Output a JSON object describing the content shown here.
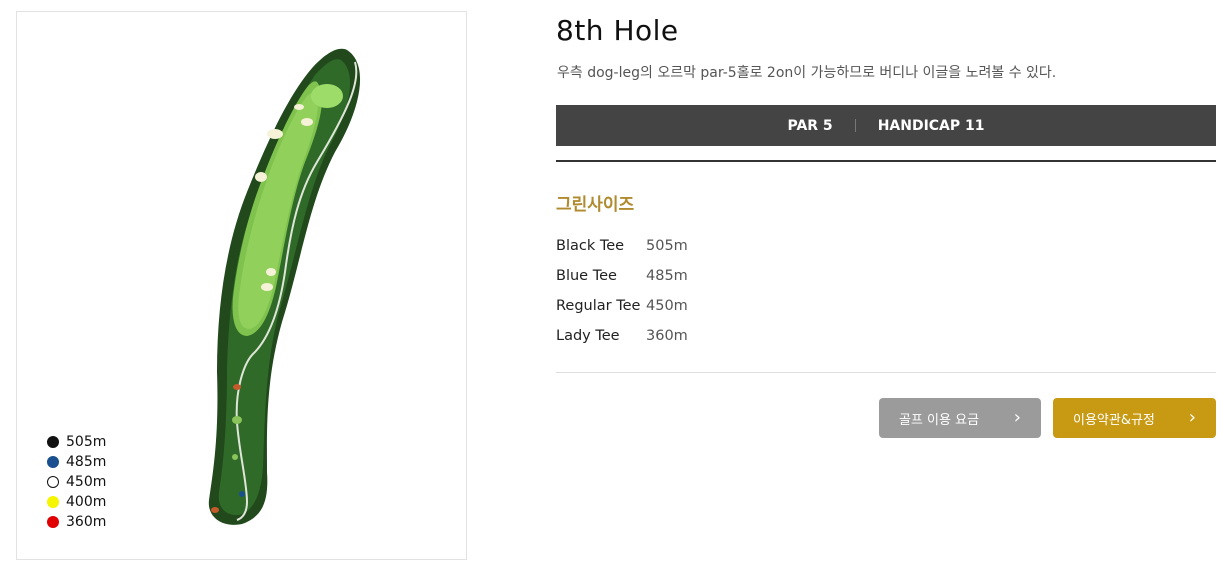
{
  "hole": {
    "title": "8th Hole",
    "description": "우측 dog-leg의 오르막 par-5홀로 2on이 가능하므로 버디나 이글을 노려볼 수 있다."
  },
  "info_bar": {
    "par": "PAR 5",
    "handicap": "HANDICAP 11"
  },
  "green_size": {
    "title": "그린사이즈",
    "tees": [
      {
        "name": "Black Tee",
        "distance": "505m"
      },
      {
        "name": "Blue Tee",
        "distance": "485m"
      },
      {
        "name": "Regular Tee",
        "distance": "450m"
      },
      {
        "name": "Lady Tee",
        "distance": "360m"
      }
    ]
  },
  "legend": [
    {
      "label": "505m",
      "color": "#111111"
    },
    {
      "label": "485m",
      "color": "#1a4f8f"
    },
    {
      "label": "450m",
      "color": "#ffffff"
    },
    {
      "label": "400m",
      "color": "#f5f500"
    },
    {
      "label": "360m",
      "color": "#e10000"
    }
  ],
  "buttons": {
    "fee": "골프 이용 요금",
    "terms": "이용약관&규정"
  },
  "icons": {
    "chevron": "chevron-right-icon"
  }
}
